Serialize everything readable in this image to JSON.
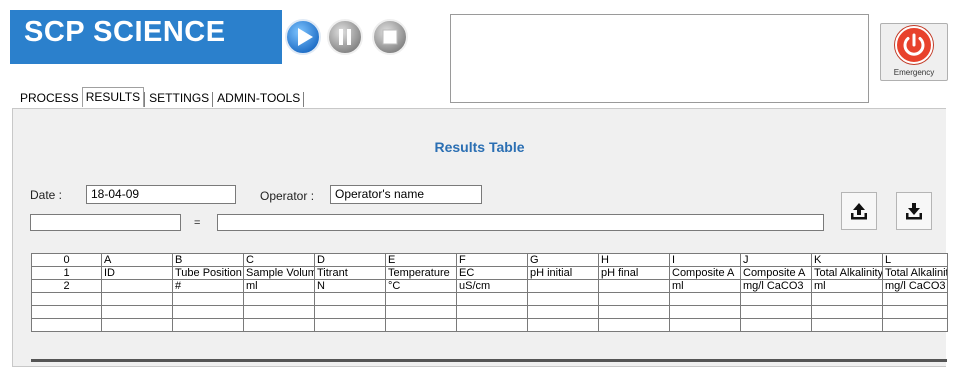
{
  "app": {
    "title": "SCP SCIENCE"
  },
  "controls": {
    "play": "play-icon",
    "pause": "pause-icon",
    "stop": "stop-icon"
  },
  "emergency": {
    "label": "Emergency"
  },
  "tabs": [
    {
      "label": "PROCESS"
    },
    {
      "label": "RESULTS"
    },
    {
      "label": "SETTINGS"
    },
    {
      "label": "ADMIN-TOOLS"
    }
  ],
  "results": {
    "title": "Results Table",
    "date_label": "Date :",
    "date_value": "18-04-09",
    "operator_label": "Operator :",
    "operator_value": "Operator's name",
    "formula_left": "",
    "equals": "=",
    "formula_right": ""
  },
  "grid": {
    "columns": [
      "0",
      "A",
      "B",
      "C",
      "D",
      "E",
      "F",
      "G",
      "H",
      "I",
      "J",
      "K",
      "L"
    ],
    "rows": [
      [
        "1",
        "ID",
        "Tube Position",
        "Sample Volume",
        "Titrant",
        "Temperature",
        "EC",
        "pH initial",
        "pH final",
        "Composite A",
        "Composite A",
        "Total Alkalinity",
        "Total Alkalinity"
      ],
      [
        "2",
        "",
        "#",
        "ml",
        "N",
        "°C",
        "uS/cm",
        "",
        "",
        "ml",
        "mg/l CaCO3",
        "ml",
        "mg/l CaCO3"
      ],
      [
        "",
        "",
        "",
        "",
        "",
        "",
        "",
        "",
        "",
        "",
        "",
        "",
        ""
      ],
      [
        "",
        "",
        "",
        "",
        "",
        "",
        "",
        "",
        "",
        "",
        "",
        "",
        ""
      ],
      [
        "",
        "",
        "",
        "",
        "",
        "",
        "",
        "",
        "",
        "",
        "",
        "",
        ""
      ]
    ]
  },
  "colors": {
    "brand": "#2b80cc",
    "title": "#2b6fb3",
    "emergency": "#e8422c"
  }
}
